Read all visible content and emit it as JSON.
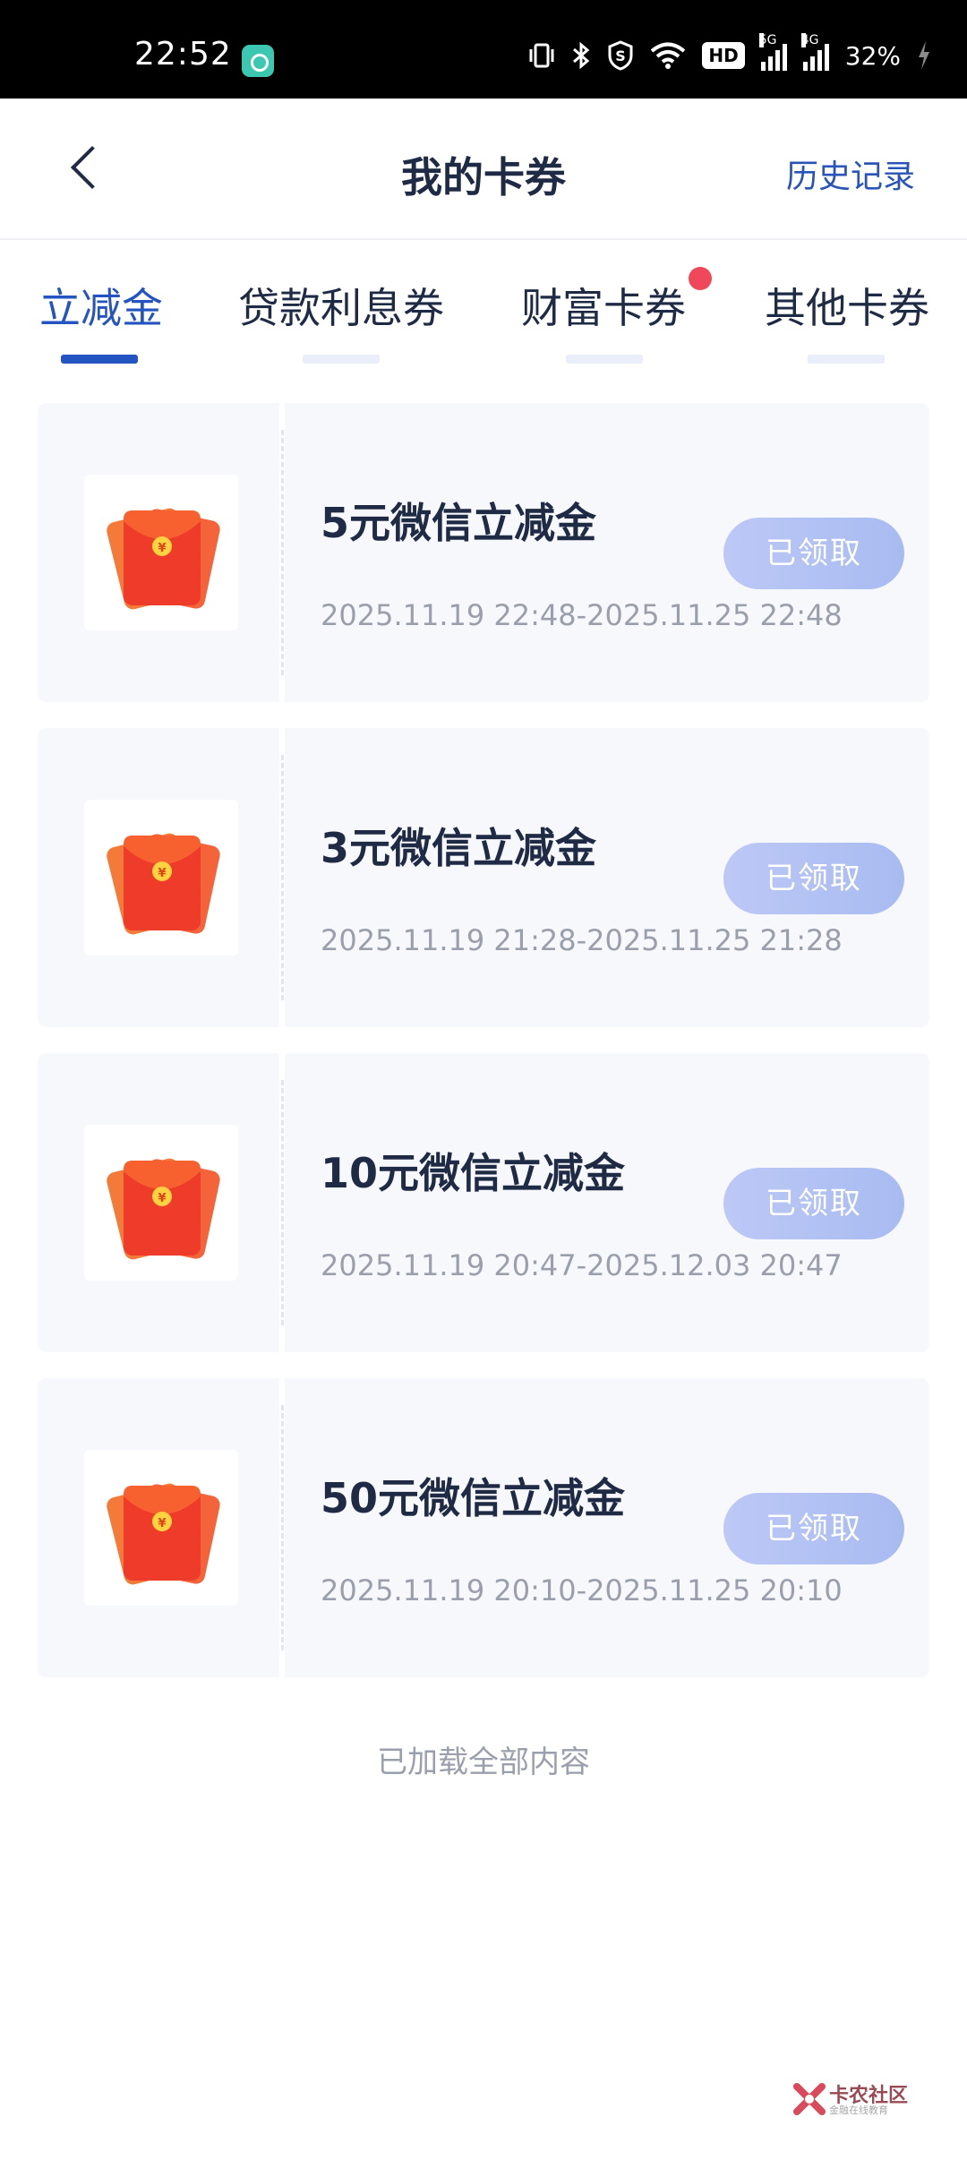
{
  "status_bar": {
    "time": "22:52",
    "network_5g": "5G",
    "network_4g": "4G",
    "hd_label": "HD",
    "battery": "32%"
  },
  "header": {
    "title": "我的卡券",
    "history_label": "历史记录"
  },
  "tabs": [
    {
      "label": "立减金",
      "active": true
    },
    {
      "label": "贷款利息券",
      "active": false
    },
    {
      "label": "财富卡券",
      "active": false,
      "has_dot": true
    },
    {
      "label": "其他卡券",
      "active": false
    }
  ],
  "coupons": [
    {
      "title": "5元微信立减金",
      "date": "2025.11.19 22:48-2025.11.25 22:48",
      "button": "已领取"
    },
    {
      "title": "3元微信立减金",
      "date": "2025.11.19 21:28-2025.11.25 21:28",
      "button": "已领取"
    },
    {
      "title": "10元微信立减金",
      "date": "2025.11.19 20:47-2025.12.03 20:47",
      "button": "已领取"
    },
    {
      "title": "50元微信立减金",
      "date": "2025.11.19 20:10-2025.11.25 20:10",
      "button": "已领取"
    }
  ],
  "footer": {
    "loaded_all": "已加载全部内容"
  },
  "watermark": {
    "name": "卡农社区",
    "sub": "金融在线教育"
  },
  "colors": {
    "accent": "#2453c2",
    "text_dark": "#1f2a44",
    "text_gray": "#9aa0ab",
    "claimed_button": "#b3c2f4",
    "red_dot": "#f0485a"
  }
}
